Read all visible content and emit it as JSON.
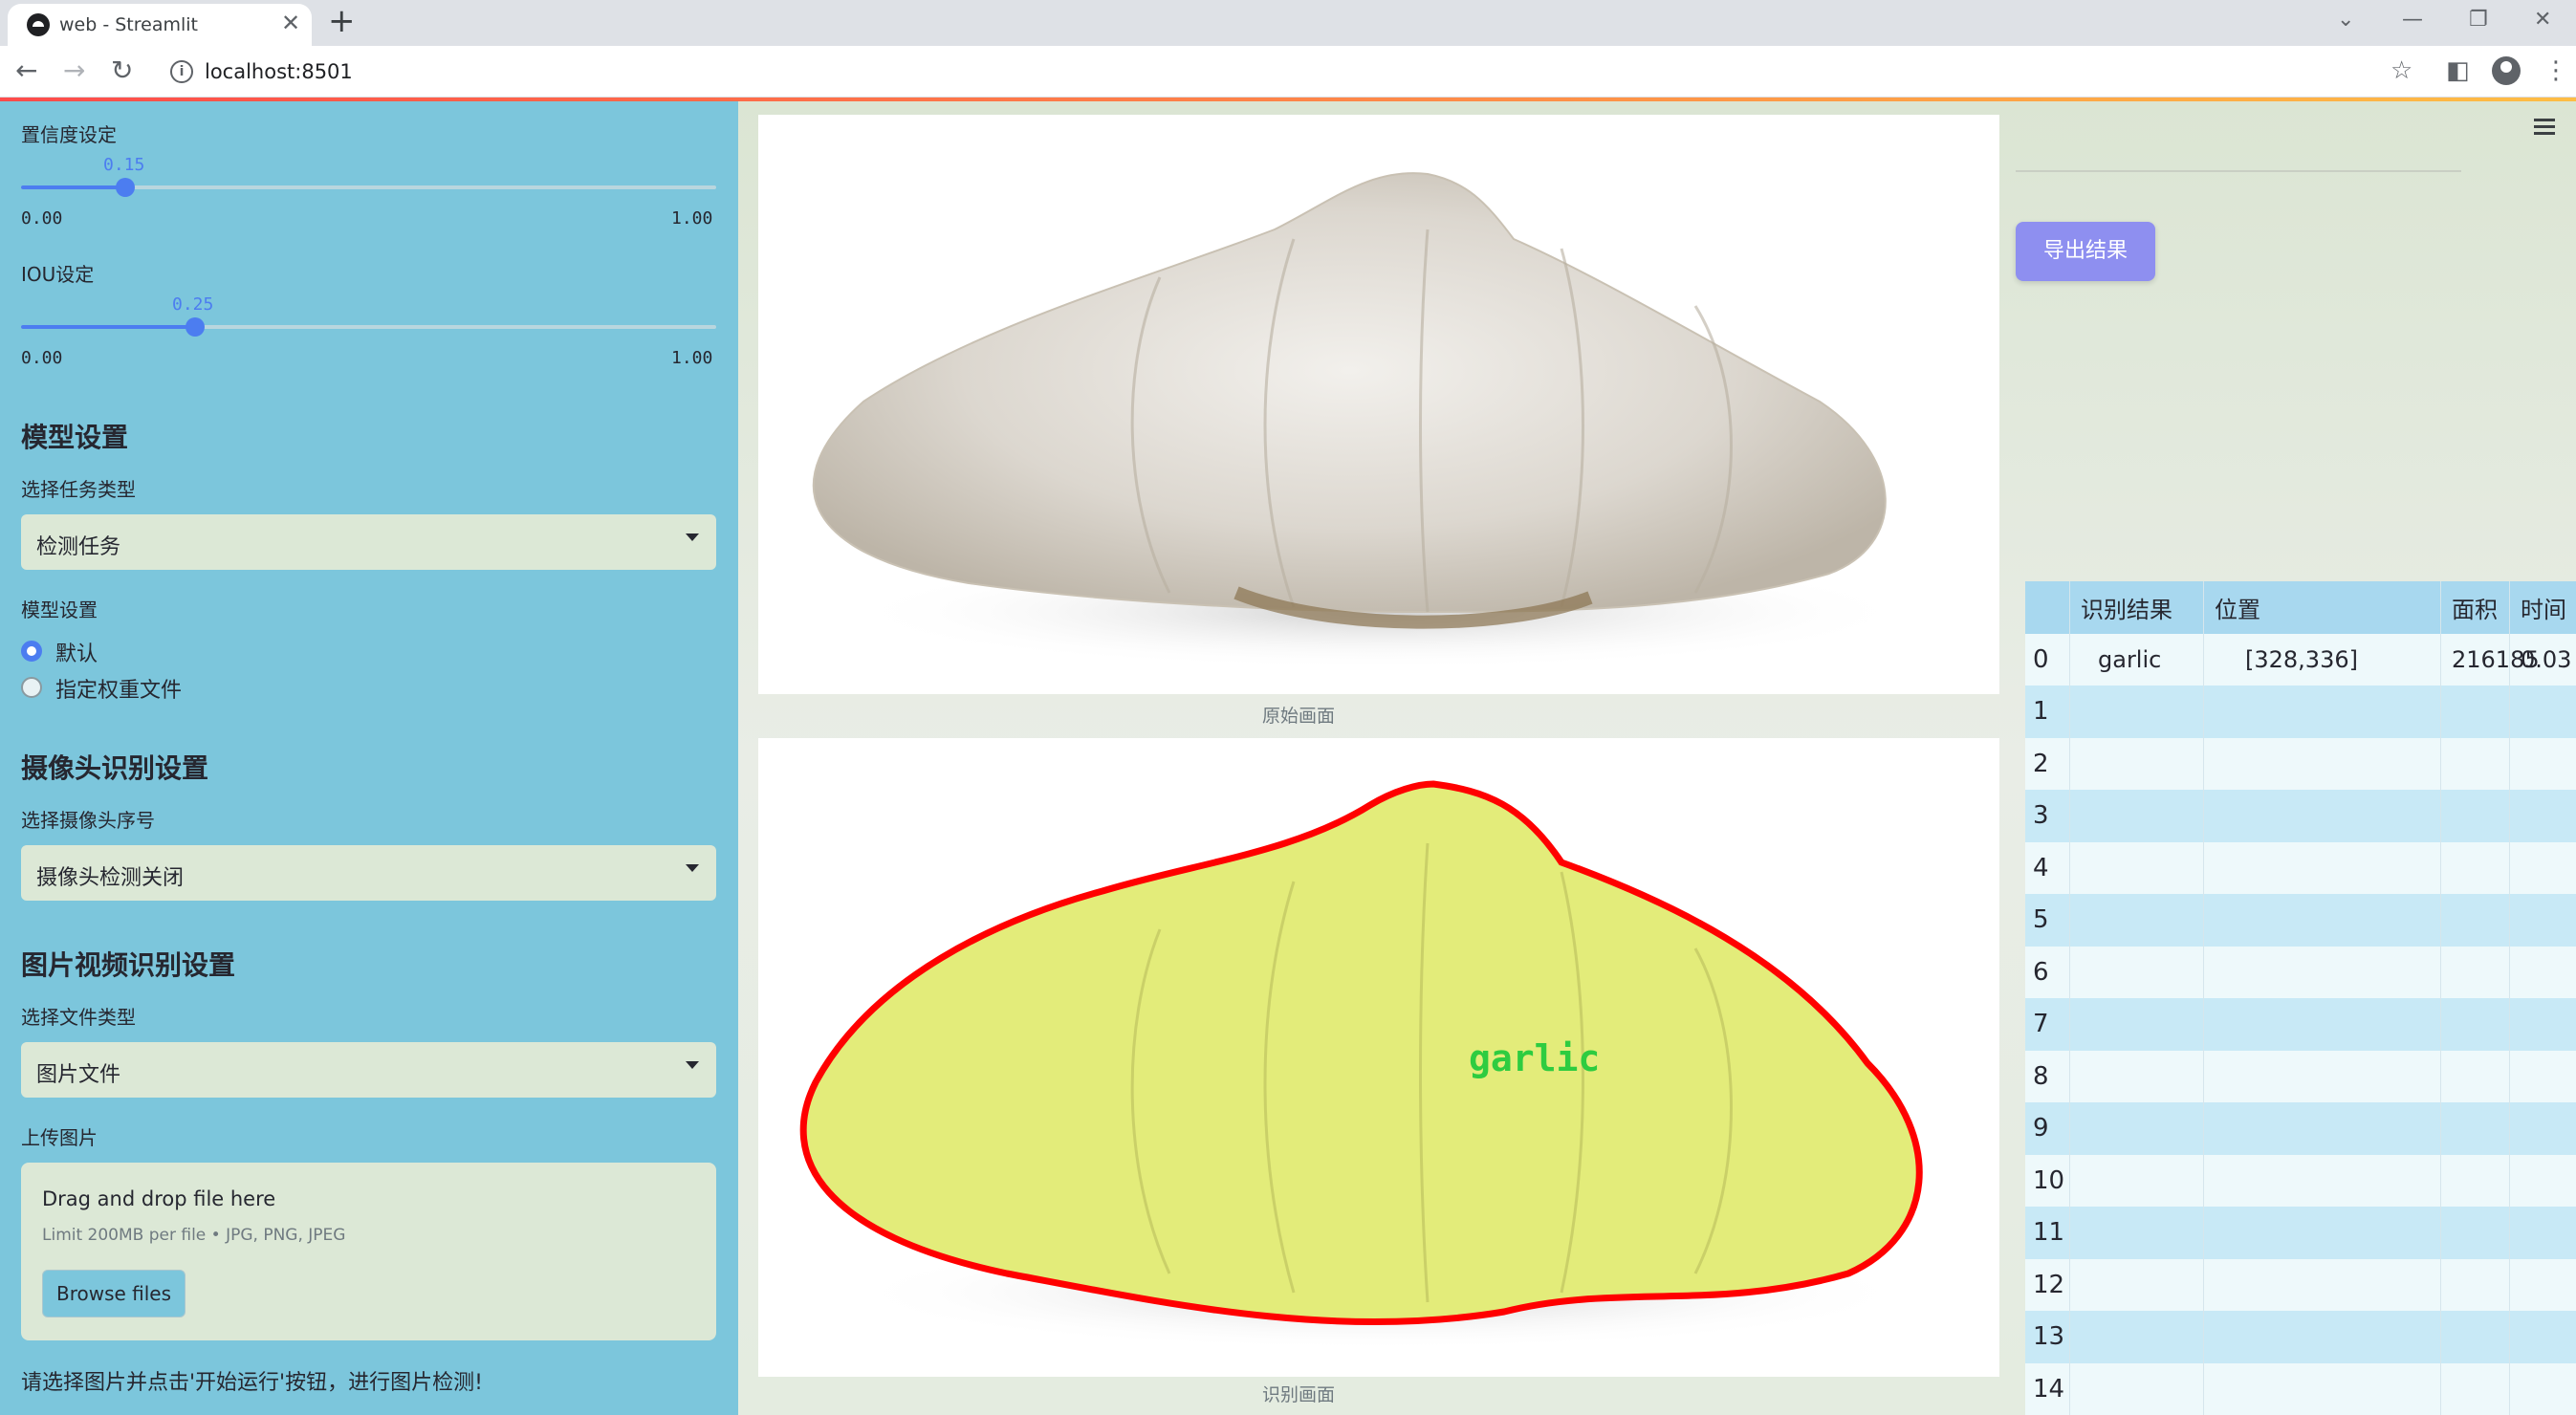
{
  "browser": {
    "tab_title": "web - Streamlit",
    "url": "localhost:8501"
  },
  "sidebar": {
    "confidence": {
      "label": "置信度设定",
      "value_text": "0.15",
      "min": "0.00",
      "max": "1.00",
      "value": 0.15
    },
    "iou": {
      "label": "IOU设定",
      "value_text": "0.25",
      "min": "0.00",
      "max": "1.00",
      "value": 0.25
    },
    "model_section": {
      "title": "模型设置",
      "task_label": "选择任务类型",
      "task_value": "检测任务",
      "model_label": "模型设置",
      "options": [
        "默认",
        "指定权重文件"
      ],
      "selected_index": 0
    },
    "camera_section": {
      "title": "摄像头识别设置",
      "camera_label": "选择摄像头序号",
      "camera_value": "摄像头检测关闭"
    },
    "media_section": {
      "title": "图片视频识别设置",
      "file_type_label": "选择文件类型",
      "file_type_value": "图片文件",
      "upload_label": "上传图片",
      "drop_title": "Drag and drop file here",
      "drop_limit": "Limit 200MB per file • JPG, PNG, JPEG",
      "browse_label": "Browse files"
    },
    "hint": "请选择图片并点击'开始运行'按钮，进行图片检测!"
  },
  "main": {
    "original_caption": "原始画面",
    "result_caption": "识别画面",
    "detection_label": "garlic",
    "export_label": "导出结果",
    "colors": {
      "mask_fill": "#e3ec7a",
      "mask_outline": "#ff0000",
      "label_text": "#2ecc40"
    }
  },
  "table": {
    "headers": [
      "",
      "识别结果",
      "位置",
      "面积",
      "时间"
    ],
    "rows": [
      [
        "0",
        "garlic",
        "[328,336]",
        "216185",
        "0.03"
      ],
      [
        "1",
        "",
        "",
        "",
        ""
      ],
      [
        "2",
        "",
        "",
        "",
        ""
      ],
      [
        "3",
        "",
        "",
        "",
        ""
      ],
      [
        "4",
        "",
        "",
        "",
        ""
      ],
      [
        "5",
        "",
        "",
        "",
        ""
      ],
      [
        "6",
        "",
        "",
        "",
        ""
      ],
      [
        "7",
        "",
        "",
        "",
        ""
      ],
      [
        "8",
        "",
        "",
        "",
        ""
      ],
      [
        "9",
        "",
        "",
        "",
        ""
      ],
      [
        "10",
        "",
        "",
        "",
        ""
      ],
      [
        "11",
        "",
        "",
        "",
        ""
      ],
      [
        "12",
        "",
        "",
        "",
        ""
      ],
      [
        "13",
        "",
        "",
        "",
        ""
      ],
      [
        "14",
        "",
        "",
        "",
        ""
      ]
    ]
  }
}
